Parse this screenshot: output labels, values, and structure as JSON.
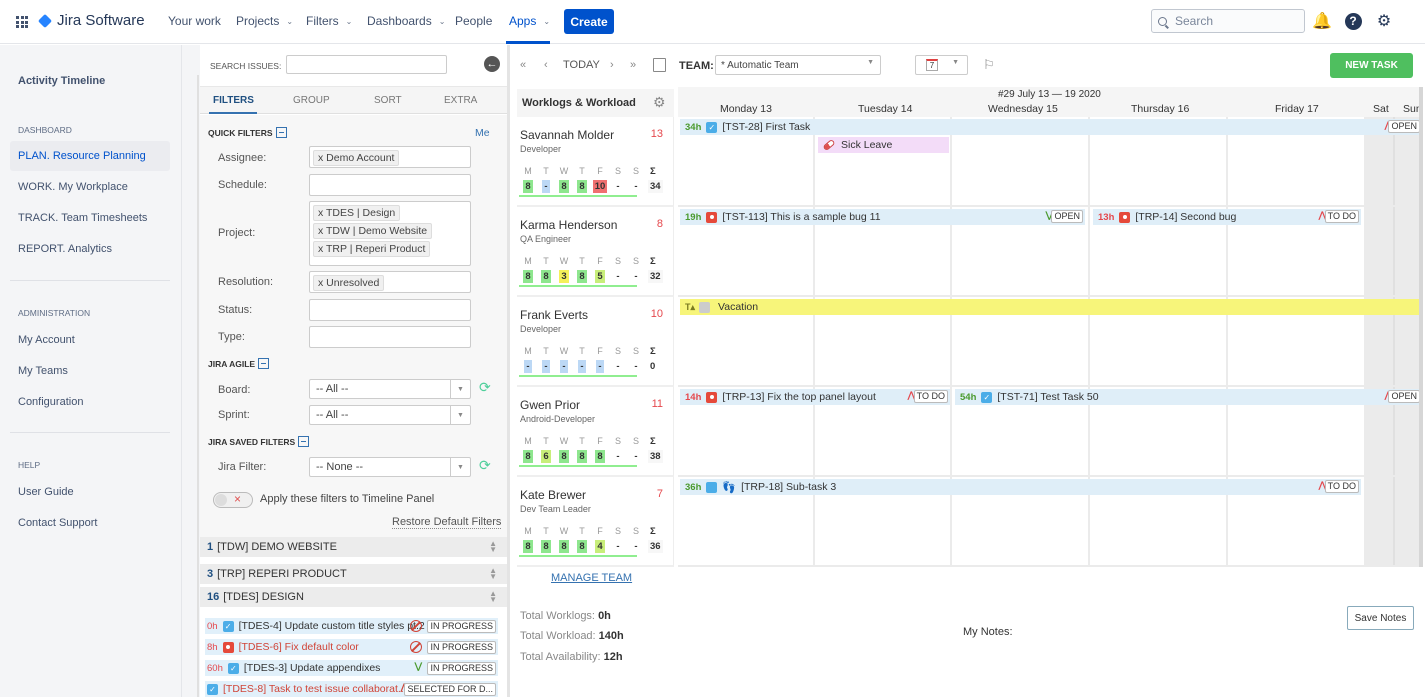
{
  "topnav": {
    "brand": "Jira Software",
    "items": [
      "Your work",
      "Projects",
      "Filters",
      "Dashboards",
      "People",
      "Apps"
    ],
    "create_label": "Create",
    "search_placeholder": "Search"
  },
  "sidebar": {
    "title": "Activity Timeline",
    "sections": [
      {
        "label": "DASHBOARD",
        "items": [
          "PLAN. Resource Planning",
          "WORK. My Workplace",
          "TRACK. Team Timesheets",
          "REPORT. Analytics"
        ]
      },
      {
        "label": "ADMINISTRATION",
        "items": [
          "My Account",
          "My Teams",
          "Configuration"
        ]
      },
      {
        "label": "HELP",
        "items": [
          "User Guide",
          "Contact Support"
        ]
      }
    ],
    "active_item": "PLAN. Resource Planning"
  },
  "filters": {
    "search_label": "SEARCH ISSUES:",
    "search_value": "",
    "tabs": [
      "FILTERS",
      "GROUP",
      "SORT",
      "EXTRA"
    ],
    "active_tab": "FILTERS",
    "quick_filters_label": "QUICK FILTERS",
    "assignee_label": "Assignee:",
    "assignee_chips": [
      "x Demo Account"
    ],
    "me_link": "Me",
    "schedule_label": "Schedule:",
    "project_label": "Project:",
    "project_chips": [
      "x TDES | Design",
      "x TDW | Demo Website",
      "x TRP | Reperi Product"
    ],
    "resolution_label": "Resolution:",
    "resolution_chips": [
      "x Unresolved"
    ],
    "status_label": "Status:",
    "type_label": "Type:",
    "jira_agile_label": "JIRA AGILE",
    "board_label": "Board:",
    "board_value": "-- All --",
    "sprint_label": "Sprint:",
    "sprint_value": "-- All --",
    "saved_filters_label": "JIRA SAVED FILTERS",
    "jira_filter_label": "Jira Filter:",
    "jira_filter_value": "-- None --",
    "apply_toggle_label": "Apply these filters to Timeline Panel",
    "apply_toggle_on": false,
    "restore_label": "Restore Default Filters"
  },
  "groups": [
    {
      "count": "1",
      "name": "[TDW] DEMO WEBSITE"
    },
    {
      "count": "3",
      "name": "[TRP] REPERI PRODUCT"
    },
    {
      "count": "16",
      "name": "[TDES] DESIGN"
    }
  ],
  "issues": [
    {
      "hours": "0h",
      "type": "task",
      "title": "[TDES-4] Update custom title styles pt.2",
      "priority": "blocker",
      "status": "IN PROGRESS",
      "red": false
    },
    {
      "hours": "8h",
      "type": "bug",
      "title": "[TDES-6] Fix default color",
      "priority": "blocker",
      "status": "IN PROGRESS",
      "red": true
    },
    {
      "hours": "60h",
      "type": "task",
      "title": "[TDES-3] Update appendixes",
      "priority": "low",
      "status": "IN PROGRESS",
      "red": false
    },
    {
      "hours": "",
      "type": "task",
      "title": "[TDES-8] Task to test issue collaborat...",
      "priority": "high",
      "status": "SELECTED FOR D...",
      "red": true
    }
  ],
  "toolbar": {
    "today_label": "TODAY",
    "team_label": "TEAM:",
    "team_value": "* Automatic Team",
    "days_value": "7",
    "new_task_label": "NEW TASK"
  },
  "calendar": {
    "panel_title": "Worklogs & Workload",
    "week_label": "#29 July 13 — 19 2020",
    "days": [
      "Monday 13",
      "Tuesday 14",
      "Wednesday 15",
      "Thursday 16",
      "Friday 17",
      "Sat",
      "Sun"
    ]
  },
  "people": [
    {
      "name": "Savannah Molder",
      "role": "Developer",
      "count": "13",
      "days": [
        "M",
        "T",
        "W",
        "T",
        "F",
        "S",
        "S"
      ],
      "values": [
        "8",
        "-",
        "8",
        "8",
        "10",
        "-",
        "-"
      ],
      "colors": [
        "g",
        "b",
        "g",
        "g",
        "r",
        "",
        ""
      ],
      "sigma": "Σ",
      "total": "34"
    },
    {
      "name": "Karma Henderson",
      "role": "QA Engineer",
      "count": "8",
      "days": [
        "M",
        "T",
        "W",
        "T",
        "F",
        "S",
        "S"
      ],
      "values": [
        "8",
        "8",
        "3",
        "8",
        "5",
        "-",
        "-"
      ],
      "colors": [
        "g",
        "g",
        "y",
        "g",
        "lg",
        "",
        ""
      ],
      "sigma": "Σ",
      "total": "32"
    },
    {
      "name": "Frank Everts",
      "role": "Developer",
      "count": "10",
      "days": [
        "M",
        "T",
        "W",
        "T",
        "F",
        "S",
        "S"
      ],
      "values": [
        "-",
        "-",
        "-",
        "-",
        "-",
        "-",
        "-"
      ],
      "colors": [
        "b",
        "b",
        "b",
        "b",
        "b",
        "",
        ""
      ],
      "sigma": "Σ",
      "total": "0"
    },
    {
      "name": "Gwen Prior",
      "role": "Android-Developer",
      "count": "11",
      "days": [
        "M",
        "T",
        "W",
        "T",
        "F",
        "S",
        "S"
      ],
      "values": [
        "8",
        "6",
        "8",
        "8",
        "8",
        "-",
        "-"
      ],
      "colors": [
        "g",
        "lg",
        "g",
        "g",
        "g",
        "",
        ""
      ],
      "sigma": "Σ",
      "total": "38"
    },
    {
      "name": "Kate Brewer",
      "role": "Dev Team Leader",
      "count": "7",
      "days": [
        "M",
        "T",
        "W",
        "T",
        "F",
        "S",
        "S"
      ],
      "values": [
        "8",
        "8",
        "8",
        "8",
        "4",
        "-",
        "-"
      ],
      "colors": [
        "g",
        "g",
        "g",
        "g",
        "lg",
        "",
        ""
      ],
      "sigma": "Σ",
      "total": "36"
    }
  ],
  "events": [
    {
      "hours": "34h",
      "type": "task",
      "title": "[TST-28] First Task",
      "priority": "high",
      "status": "OPEN"
    },
    {
      "title": "Sick Leave",
      "type": "sick"
    },
    {
      "hours": "19h",
      "type": "bug",
      "title": "[TST-113] This is a sample bug 11",
      "priority": "low",
      "status": "OPEN"
    },
    {
      "hours": "13h",
      "type": "bug",
      "title": "[TRP-14] Second bug",
      "priority": "high",
      "status": "TO DO"
    },
    {
      "title": "Vacation",
      "type": "vacation"
    },
    {
      "hours": "14h",
      "type": "bug",
      "title": "[TRP-13] Fix the top panel layout",
      "priority": "high",
      "status": "TO DO"
    },
    {
      "hours": "54h",
      "type": "task",
      "title": "[TST-71] Test Task 50",
      "priority": "high",
      "status": "OPEN"
    },
    {
      "hours": "36h",
      "type": "subtask",
      "title": "[TRP-18] Sub-task 3",
      "priority": "high",
      "status": "TO DO"
    }
  ],
  "footer": {
    "manage_team": "MANAGE TEAM",
    "total_worklogs_label": "Total Worklogs:",
    "total_worklogs": "0h",
    "total_workload_label": "Total Workload:",
    "total_workload": "140h",
    "total_availability_label": "Total Availability:",
    "total_availability": "12h",
    "notes_label": "My Notes:",
    "save_notes": "Save Notes"
  }
}
